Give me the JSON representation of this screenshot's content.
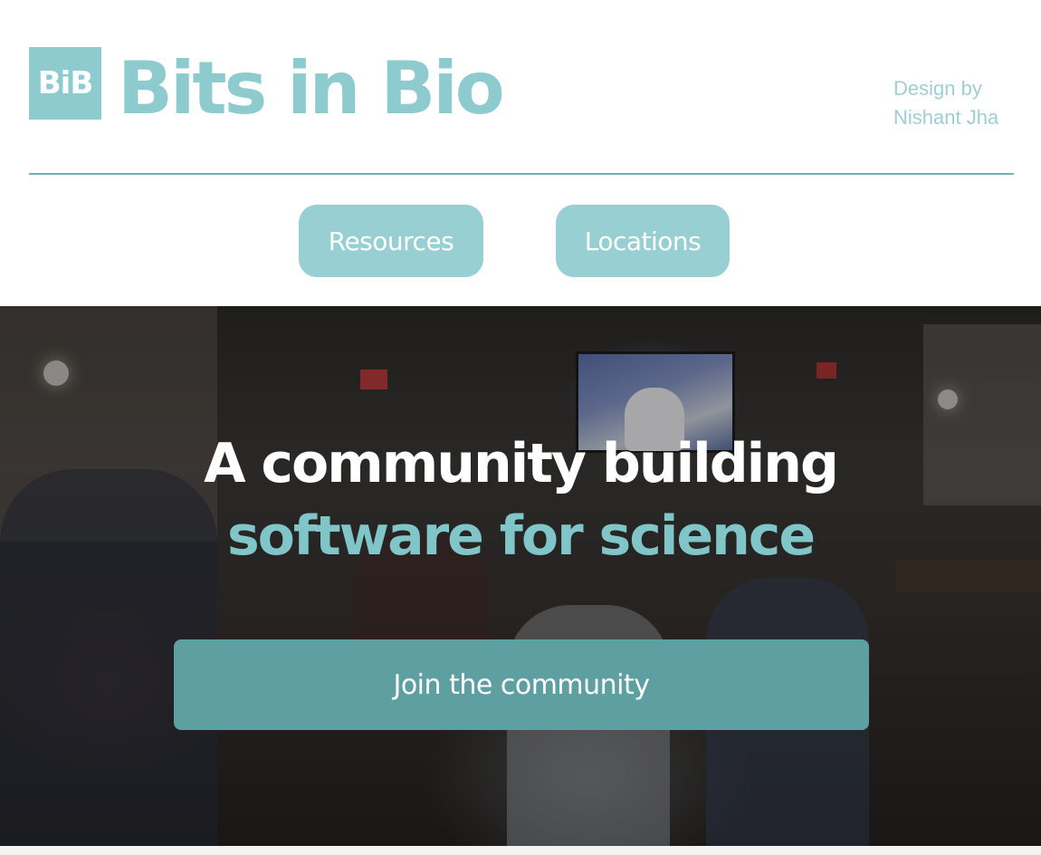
{
  "header": {
    "logo_text": "BiB",
    "title": "Bits in Bio",
    "credit_line1": "Design by",
    "credit_line2": "Nishant Jha"
  },
  "nav": {
    "items": [
      {
        "label": "Resources"
      },
      {
        "label": "Locations"
      }
    ]
  },
  "hero": {
    "headline_line1": "A community building",
    "headline_line2": "software for science",
    "cta_label": "Join the community"
  },
  "colors": {
    "brand_teal": "#8ecbce",
    "nav_pill": "#98cfd2",
    "cta_button": "#5e9fa2",
    "headline_accent": "#80c5c8",
    "divider": "#6fb2b5"
  }
}
